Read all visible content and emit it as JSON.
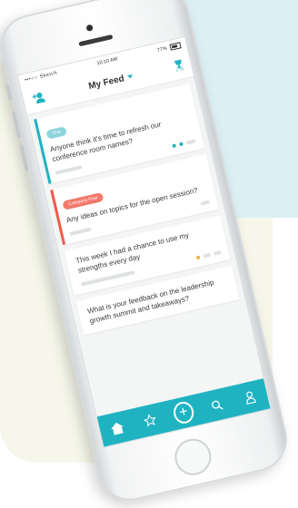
{
  "status_bar": {
    "carrier": "•••○○ Sketch",
    "time": "10:10 AM",
    "battery": "77%"
  },
  "header": {
    "title": "My Feed",
    "prize_count": "1770"
  },
  "feed": [
    {
      "badge": "Tina",
      "badge_color": "#8ed3dc",
      "bar_color": "#1fb3c2",
      "text": "Anyone think it's time to refresh our conference room names?"
    },
    {
      "badge": "Company Post",
      "badge_color": "#f2796b",
      "bar_color": "#ef5a4a",
      "text": "Any ideas on topics for the open session?"
    },
    {
      "badge": "",
      "badge_color": "",
      "bar_color": "",
      "text": "This week I had a chance to use my strengths every day"
    },
    {
      "badge": "",
      "badge_color": "",
      "bar_color": "",
      "text": "What is your feedback on the leadership growth summit and takeaways?"
    }
  ],
  "tabbar": {
    "items": [
      "home-icon",
      "star-icon",
      "add-icon",
      "search-icon",
      "profile-icon"
    ],
    "add_label": "+"
  },
  "colors": {
    "accent": "#1fb3c2",
    "company_post": "#ef5a4a"
  }
}
